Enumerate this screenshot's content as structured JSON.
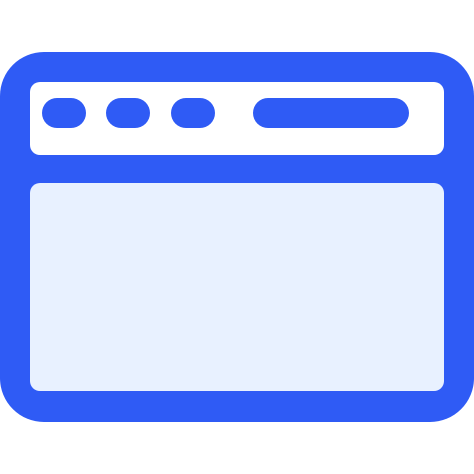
{
  "icon": {
    "name": "browser-window-icon",
    "colors": {
      "stroke": "#2F5BF5",
      "titlebar_fill": "#FFFFFF",
      "content_fill": "#E8F1FF",
      "background": "#FFFFFF"
    }
  }
}
